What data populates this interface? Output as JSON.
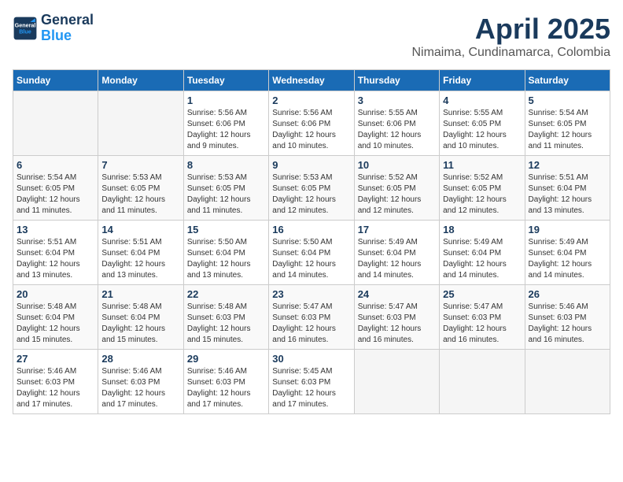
{
  "header": {
    "logo_line1": "General",
    "logo_line2": "Blue",
    "month": "April 2025",
    "location": "Nimaima, Cundinamarca, Colombia"
  },
  "weekdays": [
    "Sunday",
    "Monday",
    "Tuesday",
    "Wednesday",
    "Thursday",
    "Friday",
    "Saturday"
  ],
  "weeks": [
    [
      {
        "day": "",
        "info": ""
      },
      {
        "day": "",
        "info": ""
      },
      {
        "day": "1",
        "info": "Sunrise: 5:56 AM\nSunset: 6:06 PM\nDaylight: 12 hours and 9 minutes."
      },
      {
        "day": "2",
        "info": "Sunrise: 5:56 AM\nSunset: 6:06 PM\nDaylight: 12 hours and 10 minutes."
      },
      {
        "day": "3",
        "info": "Sunrise: 5:55 AM\nSunset: 6:06 PM\nDaylight: 12 hours and 10 minutes."
      },
      {
        "day": "4",
        "info": "Sunrise: 5:55 AM\nSunset: 6:05 PM\nDaylight: 12 hours and 10 minutes."
      },
      {
        "day": "5",
        "info": "Sunrise: 5:54 AM\nSunset: 6:05 PM\nDaylight: 12 hours and 11 minutes."
      }
    ],
    [
      {
        "day": "6",
        "info": "Sunrise: 5:54 AM\nSunset: 6:05 PM\nDaylight: 12 hours and 11 minutes."
      },
      {
        "day": "7",
        "info": "Sunrise: 5:53 AM\nSunset: 6:05 PM\nDaylight: 12 hours and 11 minutes."
      },
      {
        "day": "8",
        "info": "Sunrise: 5:53 AM\nSunset: 6:05 PM\nDaylight: 12 hours and 11 minutes."
      },
      {
        "day": "9",
        "info": "Sunrise: 5:53 AM\nSunset: 6:05 PM\nDaylight: 12 hours and 12 minutes."
      },
      {
        "day": "10",
        "info": "Sunrise: 5:52 AM\nSunset: 6:05 PM\nDaylight: 12 hours and 12 minutes."
      },
      {
        "day": "11",
        "info": "Sunrise: 5:52 AM\nSunset: 6:05 PM\nDaylight: 12 hours and 12 minutes."
      },
      {
        "day": "12",
        "info": "Sunrise: 5:51 AM\nSunset: 6:04 PM\nDaylight: 12 hours and 13 minutes."
      }
    ],
    [
      {
        "day": "13",
        "info": "Sunrise: 5:51 AM\nSunset: 6:04 PM\nDaylight: 12 hours and 13 minutes."
      },
      {
        "day": "14",
        "info": "Sunrise: 5:51 AM\nSunset: 6:04 PM\nDaylight: 12 hours and 13 minutes."
      },
      {
        "day": "15",
        "info": "Sunrise: 5:50 AM\nSunset: 6:04 PM\nDaylight: 12 hours and 13 minutes."
      },
      {
        "day": "16",
        "info": "Sunrise: 5:50 AM\nSunset: 6:04 PM\nDaylight: 12 hours and 14 minutes."
      },
      {
        "day": "17",
        "info": "Sunrise: 5:49 AM\nSunset: 6:04 PM\nDaylight: 12 hours and 14 minutes."
      },
      {
        "day": "18",
        "info": "Sunrise: 5:49 AM\nSunset: 6:04 PM\nDaylight: 12 hours and 14 minutes."
      },
      {
        "day": "19",
        "info": "Sunrise: 5:49 AM\nSunset: 6:04 PM\nDaylight: 12 hours and 14 minutes."
      }
    ],
    [
      {
        "day": "20",
        "info": "Sunrise: 5:48 AM\nSunset: 6:04 PM\nDaylight: 12 hours and 15 minutes."
      },
      {
        "day": "21",
        "info": "Sunrise: 5:48 AM\nSunset: 6:04 PM\nDaylight: 12 hours and 15 minutes."
      },
      {
        "day": "22",
        "info": "Sunrise: 5:48 AM\nSunset: 6:03 PM\nDaylight: 12 hours and 15 minutes."
      },
      {
        "day": "23",
        "info": "Sunrise: 5:47 AM\nSunset: 6:03 PM\nDaylight: 12 hours and 16 minutes."
      },
      {
        "day": "24",
        "info": "Sunrise: 5:47 AM\nSunset: 6:03 PM\nDaylight: 12 hours and 16 minutes."
      },
      {
        "day": "25",
        "info": "Sunrise: 5:47 AM\nSunset: 6:03 PM\nDaylight: 12 hours and 16 minutes."
      },
      {
        "day": "26",
        "info": "Sunrise: 5:46 AM\nSunset: 6:03 PM\nDaylight: 12 hours and 16 minutes."
      }
    ],
    [
      {
        "day": "27",
        "info": "Sunrise: 5:46 AM\nSunset: 6:03 PM\nDaylight: 12 hours and 17 minutes."
      },
      {
        "day": "28",
        "info": "Sunrise: 5:46 AM\nSunset: 6:03 PM\nDaylight: 12 hours and 17 minutes."
      },
      {
        "day": "29",
        "info": "Sunrise: 5:46 AM\nSunset: 6:03 PM\nDaylight: 12 hours and 17 minutes."
      },
      {
        "day": "30",
        "info": "Sunrise: 5:45 AM\nSunset: 6:03 PM\nDaylight: 12 hours and 17 minutes."
      },
      {
        "day": "",
        "info": ""
      },
      {
        "day": "",
        "info": ""
      },
      {
        "day": "",
        "info": ""
      }
    ]
  ]
}
